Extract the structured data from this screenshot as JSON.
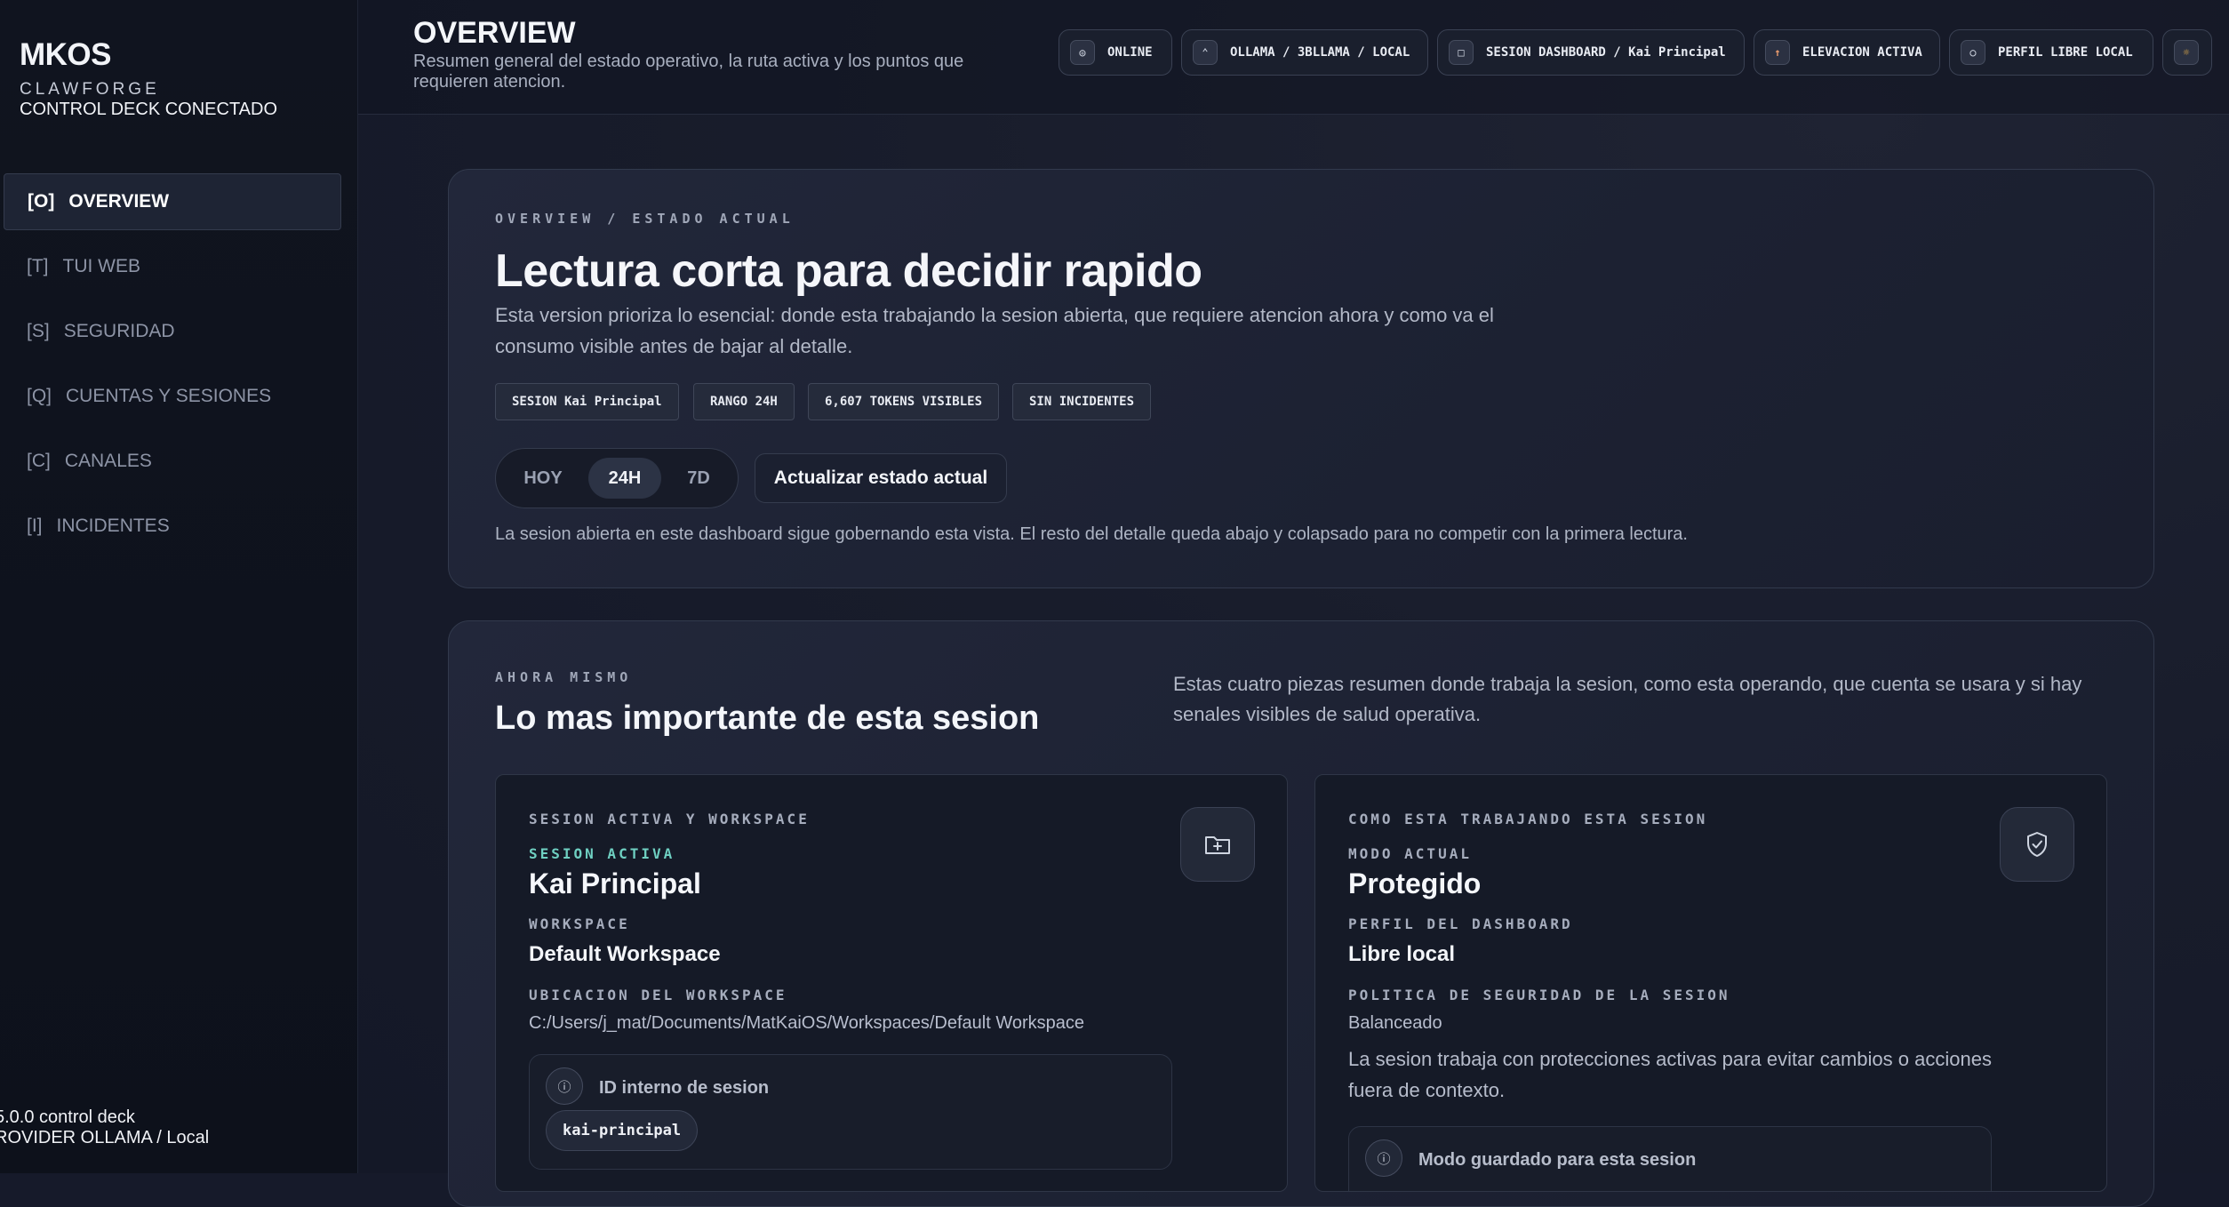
{
  "sidebar": {
    "brand": "MKOS",
    "subtitle": "CLAWFORGE",
    "status": "CONTROL DECK CONECTADO",
    "items": [
      {
        "key": "[O]",
        "label": "OVERVIEW"
      },
      {
        "key": "[T]",
        "label": "TUI WEB"
      },
      {
        "key": "[S]",
        "label": "SEGURIDAD"
      },
      {
        "key": "[Q]",
        "label": "CUENTAS Y SESIONES"
      },
      {
        "key": "[C]",
        "label": "CANALES"
      },
      {
        "key": "[I]",
        "label": "INCIDENTES"
      }
    ],
    "footer_version": "5.0.0 control deck",
    "footer_provider": "ROVIDER OLLAMA / Local"
  },
  "header": {
    "title": "OVERVIEW",
    "description": "Resumen general del estado operativo, la ruta activa y los puntos que requieren atencion.",
    "chips": [
      {
        "label": "ONLINE",
        "icon": "online-icon"
      },
      {
        "label": "OLLAMA / 3BLLAMA / LOCAL",
        "icon": "model-icon"
      },
      {
        "label": "SESION DASHBOARD / Kai Principal",
        "icon": "session-icon"
      },
      {
        "label": "ELEVACION ACTIVA",
        "icon": "elevation-icon"
      },
      {
        "label": "PERFIL LIBRE LOCAL",
        "icon": "profile-icon"
      }
    ],
    "theme_icon": "sun-icon"
  },
  "hero": {
    "eyebrow": "OVERVIEW / ESTADO ACTUAL",
    "title": "Lectura corta para decidir rapido",
    "description": "Esta version prioriza lo esencial: donde esta trabajando la sesion abierta, que requiere atencion ahora y como va el consumo visible antes de bajar al detalle.",
    "tags": [
      "SESION Kai Principal",
      "RANGO 24H",
      "6,607 TOKENS VISIBLES",
      "SIN INCIDENTES"
    ],
    "range_options": [
      "HOY",
      "24H",
      "7D"
    ],
    "range_selected": "24H",
    "refresh_label": "Actualizar estado actual",
    "note": "La sesion abierta en este dashboard sigue gobernando esta vista. El resto del detalle queda abajo y colapsado para no competir con la primera lectura."
  },
  "session": {
    "eyebrow": "AHORA MISMO",
    "title": "Lo mas importante de esta sesion",
    "description": "Estas cuatro piezas resumen donde trabaja la sesion, como esta operando, que cuenta se usara y si hay senales visibles de salud operativa.",
    "workspace_card": {
      "heading": "SESION ACTIVA Y WORKSPACE",
      "active_label": "SESION ACTIVA",
      "active_value": "Kai Principal",
      "workspace_label": "WORKSPACE",
      "workspace_value": "Default Workspace",
      "location_label": "UBICACION DEL WORKSPACE",
      "location_value": "C:/Users/j_mat/Documents/MatKaiOS/Workspaces/Default Workspace",
      "id_label": "ID interno de sesion",
      "id_value": "kai-principal",
      "icon": "folder-plus-icon"
    },
    "mode_card": {
      "heading": "COMO ESTA TRABAJANDO ESTA SESION",
      "mode_label": "MODO ACTUAL",
      "mode_value": "Protegido",
      "profile_label": "PERFIL DEL DASHBOARD",
      "profile_value": "Libre local",
      "policy_label": "POLITICA DE SEGURIDAD DE LA SESION",
      "policy_value": "Balanceado",
      "description": "La sesion trabaja con protecciones activas para evitar cambios o acciones fuera de contexto.",
      "saved_mode_label": "Modo guardado para esta sesion",
      "icon": "shield-check-icon"
    }
  }
}
